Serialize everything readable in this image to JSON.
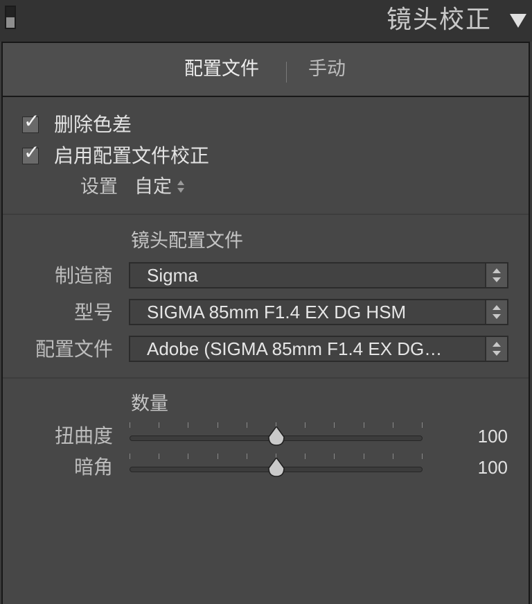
{
  "panel": {
    "title": "镜头校正"
  },
  "tabs": [
    {
      "label": "配置文件",
      "active": true
    },
    {
      "label": "手动",
      "active": false
    }
  ],
  "options": {
    "remove_ca": {
      "label": "删除色差",
      "checked": true
    },
    "enable_profile": {
      "label": "启用配置文件校正",
      "checked": true
    },
    "setup": {
      "label": "设置",
      "value": "自定"
    }
  },
  "lens_profile": {
    "section_title": "镜头配置文件",
    "make": {
      "label": "制造商",
      "value": "Sigma"
    },
    "model": {
      "label": "型号",
      "value": "SIGMA 85mm F1.4 EX DG HSM"
    },
    "profile": {
      "label": "配置文件",
      "value": "Adobe (SIGMA 85mm F1.4 EX DG…"
    }
  },
  "amount": {
    "section_title": "数量",
    "distortion": {
      "label": "扭曲度",
      "value": "100",
      "level": 0.5
    },
    "vignetting": {
      "label": "暗角",
      "value": "100",
      "level": 0.5
    }
  }
}
